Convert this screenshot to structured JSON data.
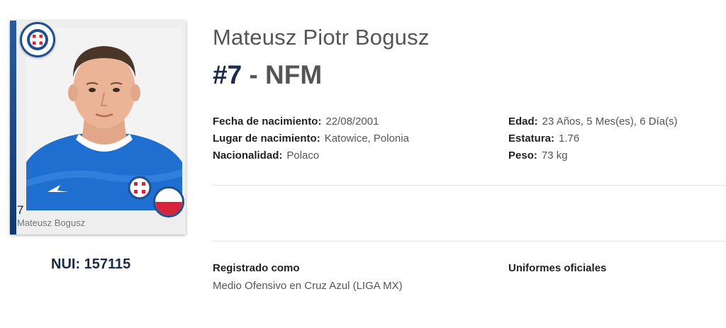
{
  "player": {
    "full_name": "Mateusz Piotr Bogusz",
    "number": "#7",
    "separator": " - ",
    "code": "NFM",
    "nui": "NUI: 157115"
  },
  "card": {
    "number": "7",
    "name": "Mateusz Bogusz",
    "club_badge_icon": "cruz-azul-crest-icon",
    "flag_icon": "poland-flag-icon",
    "colors": {
      "club_blue": "#1f4f8f",
      "jersey_blue": "#1e6fd0",
      "flag_red": "#d6243b"
    }
  },
  "details": {
    "birth_date": {
      "label": "Fecha de nacimiento:",
      "value": "22/08/2001"
    },
    "birth_place": {
      "label": "Lugar de nacimiento:",
      "value": "Katowice, Polonia"
    },
    "nationality": {
      "label": "Nacionalidad:",
      "value": "Polaco"
    },
    "age": {
      "label": "Edad:",
      "value": "23 Años, 5 Mes(es), 6 Día(s)"
    },
    "height": {
      "label": "Estatura:",
      "value": "1.76"
    },
    "weight": {
      "label": "Peso:",
      "value": "73 kg"
    }
  },
  "registration": {
    "title": "Registrado como",
    "value": "Medio Ofensivo en Cruz Azul (LIGA MX)"
  },
  "uniforms": {
    "title": "Uniformes oficiales"
  }
}
